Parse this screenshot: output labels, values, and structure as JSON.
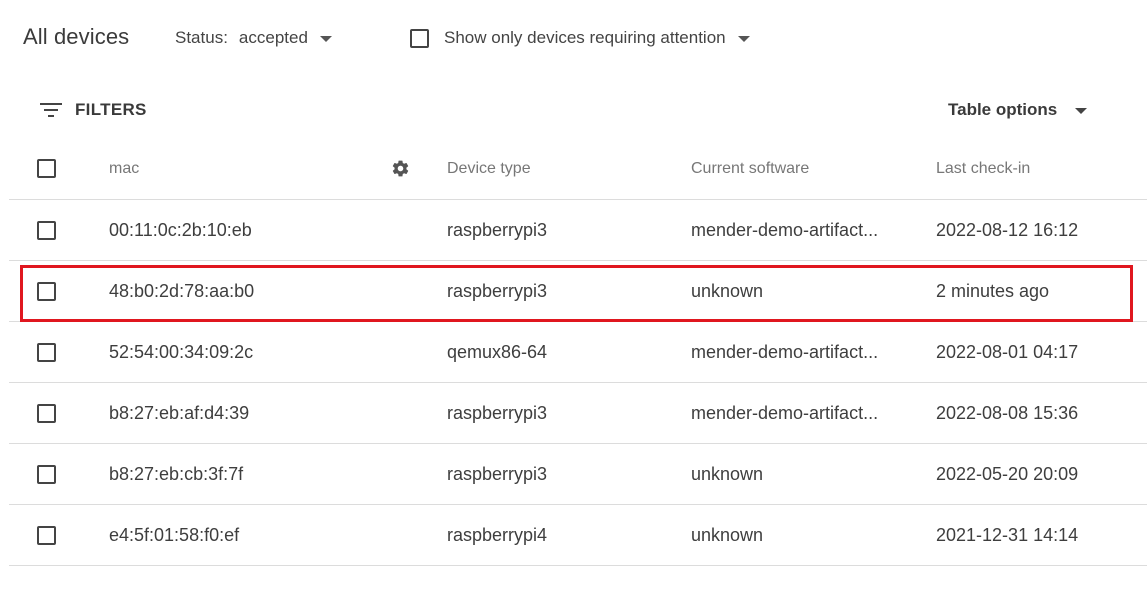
{
  "header": {
    "title": "All devices",
    "status_label": "Status:",
    "status_value": "accepted",
    "attention_label": "Show only devices requiring attention"
  },
  "toolbar": {
    "filters_label": "FILTERS",
    "table_options_label": "Table options"
  },
  "table": {
    "columns": {
      "mac": "mac",
      "device_type": "Device type",
      "current_software": "Current software",
      "last_checkin": "Last check-in"
    },
    "rows": [
      {
        "mac": "00:11:0c:2b:10:eb",
        "device_type": "raspberrypi3",
        "current_software": "mender-demo-artifact...",
        "last_checkin": "2022-08-12 16:12"
      },
      {
        "mac": "48:b0:2d:78:aa:b0",
        "device_type": "raspberrypi3",
        "current_software": "unknown",
        "last_checkin": "2 minutes ago"
      },
      {
        "mac": "52:54:00:34:09:2c",
        "device_type": "qemux86-64",
        "current_software": "mender-demo-artifact...",
        "last_checkin": "2022-08-01 04:17"
      },
      {
        "mac": "b8:27:eb:af:d4:39",
        "device_type": "raspberrypi3",
        "current_software": "mender-demo-artifact...",
        "last_checkin": "2022-08-08 15:36"
      },
      {
        "mac": "b8:27:eb:cb:3f:7f",
        "device_type": "raspberrypi3",
        "current_software": "unknown",
        "last_checkin": "2022-05-20 20:09"
      },
      {
        "mac": "e4:5f:01:58:f0:ef",
        "device_type": "raspberrypi4",
        "current_software": "unknown",
        "last_checkin": "2021-12-31 14:14"
      }
    ]
  },
  "icons": {
    "filter": "filter-list-icon",
    "gear": "gear-icon",
    "dropdown": "caret-down-icon"
  },
  "colors": {
    "highlight": "#e0171f",
    "divider": "#dcdcdc"
  }
}
